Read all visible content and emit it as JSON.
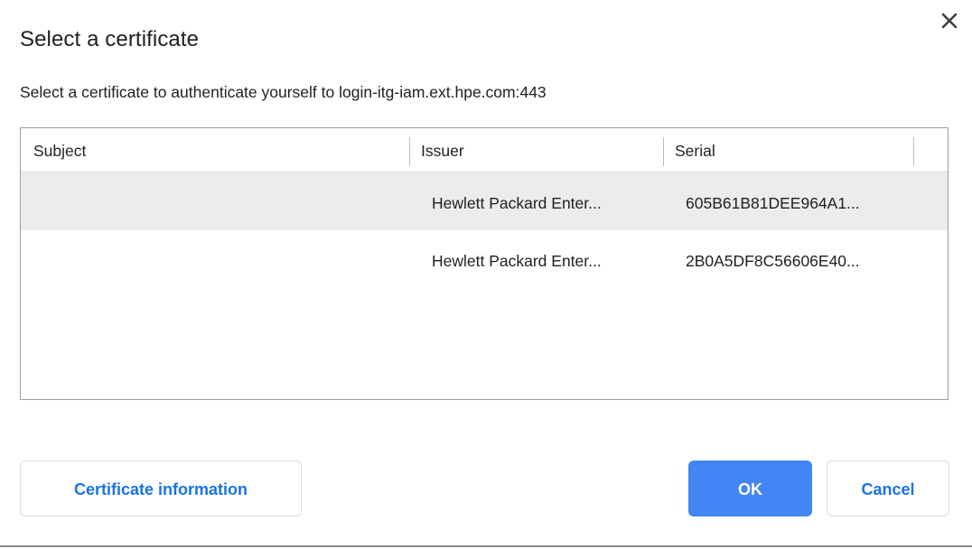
{
  "dialog": {
    "title": "Select a certificate",
    "description": "Select a certificate to authenticate yourself to login-itg-iam.ext.hpe.com:443",
    "close_icon": "close-icon"
  },
  "table": {
    "columns": [
      "Subject",
      "Issuer",
      "Serial"
    ],
    "rows": [
      {
        "subject": "",
        "issuer": "Hewlett Packard Enter...",
        "serial": "605B61B81DEE964A1...",
        "selected": true
      },
      {
        "subject": "",
        "issuer": "Hewlett Packard Enter...",
        "serial": "2B0A5DF8C56606E40...",
        "selected": false
      }
    ]
  },
  "buttons": {
    "info_label": "Certificate information",
    "ok_label": "OK",
    "cancel_label": "Cancel"
  },
  "colors": {
    "primary": "#4285f4",
    "link_text": "#1a73e8",
    "selected_row": "#ececec"
  }
}
